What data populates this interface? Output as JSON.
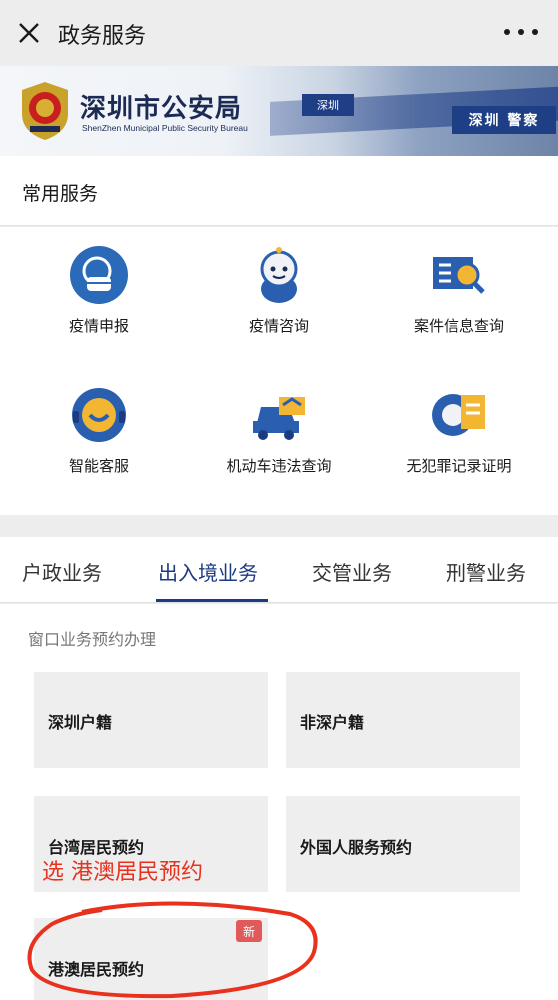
{
  "topbar": {
    "title": "政务服务",
    "close_icon": "close-icon",
    "more_icon": "more-icon"
  },
  "banner": {
    "name": "深圳市公安局",
    "subtitle": "ShenZhen Municipal Public Security Bureau",
    "sign_left": "深圳",
    "sign_right": "深圳 警察"
  },
  "common": {
    "title": "常用服务",
    "items": [
      {
        "label": "疫情申报",
        "icon": "mask-face-icon"
      },
      {
        "label": "疫情咨询",
        "icon": "mascot-icon"
      },
      {
        "label": "案件信息查询",
        "icon": "case-search-icon"
      },
      {
        "label": "智能客服",
        "icon": "smart-service-icon"
      },
      {
        "label": "机动车违法查询",
        "icon": "vehicle-icon"
      },
      {
        "label": "无犯罪记录证明",
        "icon": "certificate-icon"
      }
    ]
  },
  "tabs": [
    {
      "label": "户政业务",
      "active": false
    },
    {
      "label": "出入境业务",
      "active": true
    },
    {
      "label": "交管业务",
      "active": false
    },
    {
      "label": "刑警业务",
      "active": false
    }
  ],
  "content": {
    "subtitle": "窗口业务预约办理",
    "cards": [
      {
        "label": "深圳户籍"
      },
      {
        "label": "非深户籍"
      },
      {
        "label": "台湾居民预约"
      },
      {
        "label": "外国人服务预约"
      },
      {
        "label": "港澳居民预约",
        "badge": "新"
      }
    ],
    "annotation": "选 港澳居民预约"
  },
  "colors": {
    "accent": "#1c3b84",
    "annotation": "#e8321e",
    "badge": "#e05a5a"
  }
}
